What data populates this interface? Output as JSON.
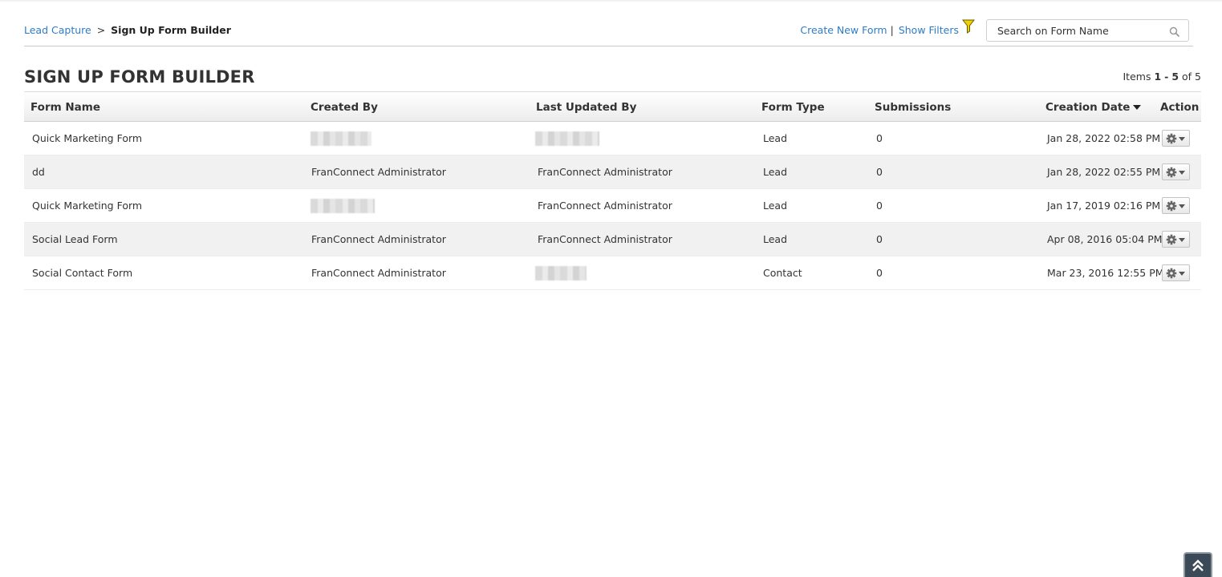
{
  "breadcrumb": {
    "parent": "Lead Capture",
    "separator": ">",
    "current": "Sign Up Form Builder"
  },
  "top_actions": {
    "create_new_form": "Create New Form",
    "separator": "|",
    "show_filters": "Show Filters",
    "filter_icon": "funnel-icon"
  },
  "search": {
    "placeholder": "Search on Form Name",
    "icon": "search-icon"
  },
  "page_title": "SIGN UP FORM BUILDER",
  "items": {
    "prefix": "Items",
    "start": "1",
    "dash": "-",
    "end": "5",
    "of_label": "of",
    "total": "5"
  },
  "table": {
    "columns": {
      "form_name": "Form Name",
      "created_by": "Created By",
      "last_updated_by": "Last Updated By",
      "form_type": "Form Type",
      "submissions": "Submissions",
      "creation_date": "Creation Date",
      "action": "Action"
    },
    "sort_column": "creation_date",
    "sort_direction": "descending",
    "rows": [
      {
        "form_name": "Quick Marketing Form",
        "created_by": "",
        "last_updated_by": "",
        "form_type": "Lead",
        "submissions": "0",
        "creation_date": "Jan 28, 2022 02:58 PM"
      },
      {
        "form_name": "dd",
        "created_by": "FranConnect Administrator",
        "last_updated_by": "FranConnect Administrator",
        "form_type": "Lead",
        "submissions": "0",
        "creation_date": "Jan 28, 2022 02:55 PM"
      },
      {
        "form_name": "Quick Marketing Form",
        "created_by": "",
        "last_updated_by": "FranConnect Administrator",
        "form_type": "Lead",
        "submissions": "0",
        "creation_date": "Jan 17, 2019 02:16 PM"
      },
      {
        "form_name": "Social Lead Form",
        "created_by": "FranConnect Administrator",
        "last_updated_by": "FranConnect Administrator",
        "form_type": "Lead",
        "submissions": "0",
        "creation_date": "Apr 08, 2016 05:04 PM"
      },
      {
        "form_name": "Social Contact Form",
        "created_by": "FranConnect Administrator",
        "last_updated_by": "",
        "form_type": "Contact",
        "submissions": "0",
        "creation_date": "Mar 23, 2016 12:55 PM"
      }
    ],
    "action_icon": "gear-dropdown-icon"
  },
  "scroll_top_icon": "double-chevron-up-icon",
  "colors": {
    "link": "#2f7bc7",
    "filter_icon": "#e8c000",
    "scroll_button": "#3b4a56"
  }
}
